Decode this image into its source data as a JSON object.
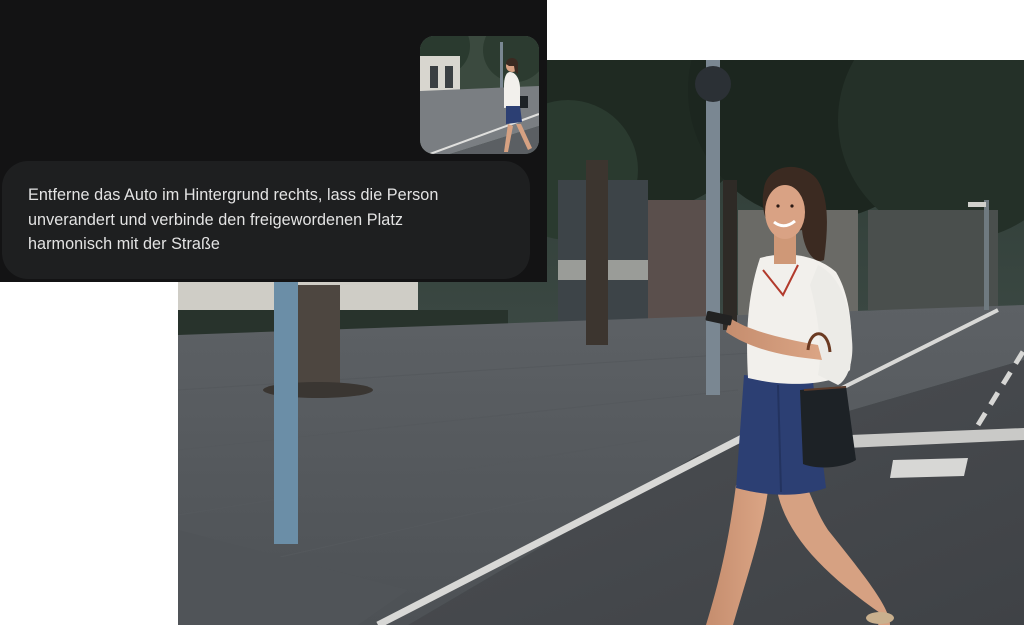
{
  "chat": {
    "prompt_text": "Entferne das Auto im Hintergrund rechts, lass die Person\nunverandert und verbinde den freigewordenen Platz\nharmonisch mit der Straße",
    "thumbnail_image": "woman-crossing-street-thumbnail"
  },
  "result": {
    "image": "edited-photo-woman-crossing-street"
  }
}
